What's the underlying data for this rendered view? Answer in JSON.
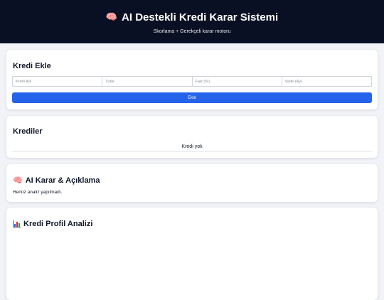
{
  "header": {
    "title_icon": "brain-icon",
    "title": "AI Destekli Kredi Karar Sistemi",
    "subtitle": "Skorlama + Gerekçeli karar motoru"
  },
  "kredi_ekle": {
    "title": "Kredi Ekle",
    "fields": [
      {
        "placeholder": "Kredi Adı",
        "value": ""
      },
      {
        "placeholder": "Tutar",
        "value": ""
      },
      {
        "placeholder": "Faiz (%)",
        "value": ""
      },
      {
        "placeholder": "Vade (Ay)",
        "value": ""
      }
    ],
    "button_label": "Ekle",
    "button_color": "#2563eb"
  },
  "krediler": {
    "title": "Krediler",
    "empty_text": "Kredi yok"
  },
  "ai_karar": {
    "title_icon": "brain-icon",
    "title": "AI Karar & Açıklama",
    "text": "Henüz analiz yapılmadı."
  },
  "profil": {
    "title_icon": "bar-chart-icon",
    "title": "Kredi Profil Analizi"
  },
  "colors": {
    "header_bg": "#0a1023",
    "page_bg": "#f1f3f7",
    "accent": "#2563eb"
  }
}
